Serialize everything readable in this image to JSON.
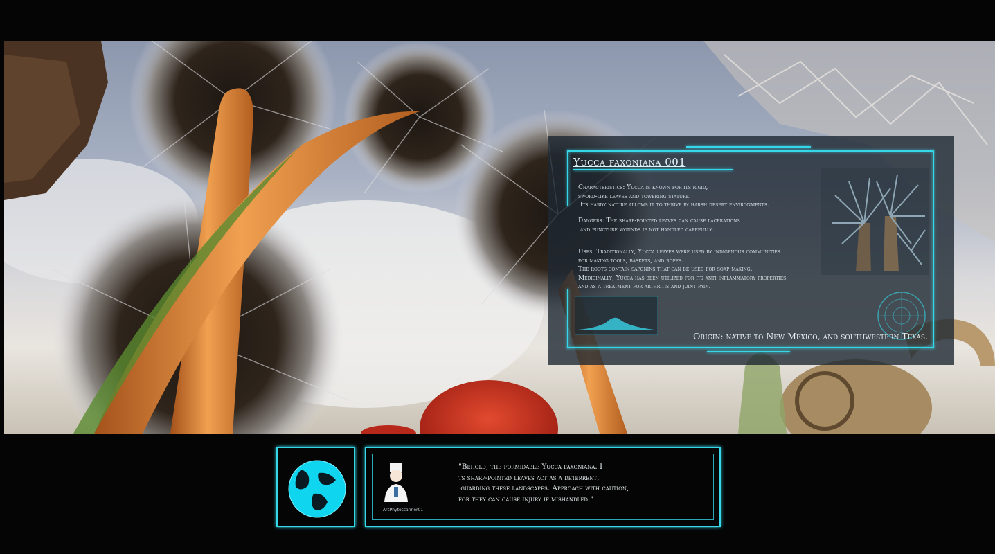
{
  "info_panel": {
    "title": "Yucca faxoniana 001",
    "characteristics": "Characteristics: Yucca is known for its rigid,\nsword-like leaves and towering stature.\n Its hardy nature allows it to thrive in harsh desert environments.",
    "dangers": "Dangers: The sharp-pointed leaves can cause lacerations\n and puncture wounds if not handled carefully.",
    "uses": "Uses: Traditionally, Yucca leaves were used by indigenous communities\nfor making tools, baskets, and ropes.\nThe roots contain saponins that can be used for soap-making.\nMedicinally, Yucca has been utilized for its anti-inflammatory properties\nand as a treatment for arthritis and joint pain.",
    "origin": "Origin: native to New Mexico, and southwestern Texas.",
    "icons": [
      "plant-thumbnail",
      "radar-icon",
      "waveform-graph"
    ]
  },
  "dialogue": {
    "speaker_name": "ArcPhytoscanner01",
    "text": "\"Behold, the formidable Yucca faxoniana. I\nts sharp-pointed leaves act as a deterrent,\n guarding these landscapes. Approach with caution,\nfor they can cause injury if mishandled.\"",
    "icons": [
      "globe-icon",
      "scientist-avatar"
    ]
  },
  "colors": {
    "hud_accent": "#36d7e8",
    "panel_bg": "rgba(30,40,50,0.80)",
    "letterbox": "#050505"
  }
}
